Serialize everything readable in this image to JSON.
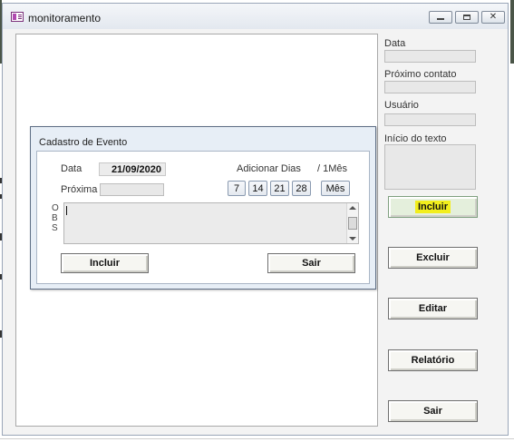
{
  "window": {
    "title": "monitoramento"
  },
  "side_panel": {
    "data_label": "Data",
    "proximo_contato_label": "Próximo contato",
    "usuario_label": "Usuário",
    "inicio_texto_label": "Início do texto",
    "buttons": {
      "incluir": "Incluir",
      "excluir": "Excluir",
      "editar": "Editar",
      "relatorio": "Relatório",
      "sair": "Sair"
    }
  },
  "dialog": {
    "title": "Cadastro de Evento",
    "data_label": "Data",
    "data_value": "21/09/2020",
    "proxima_label": "Próxima",
    "adicionar_dias_label": "Adicionar Dias",
    "um_mes_label": "/ 1Mês",
    "day_buttons": [
      "7",
      "14",
      "21",
      "28"
    ],
    "mes_button": "Mês",
    "obs_letters": [
      "O",
      "B",
      "S"
    ],
    "incluir_button": "Incluir",
    "sair_button": "Sair"
  },
  "colors": {
    "highlight": "#f2ee1d",
    "dialog_background": "#e7eef6"
  }
}
